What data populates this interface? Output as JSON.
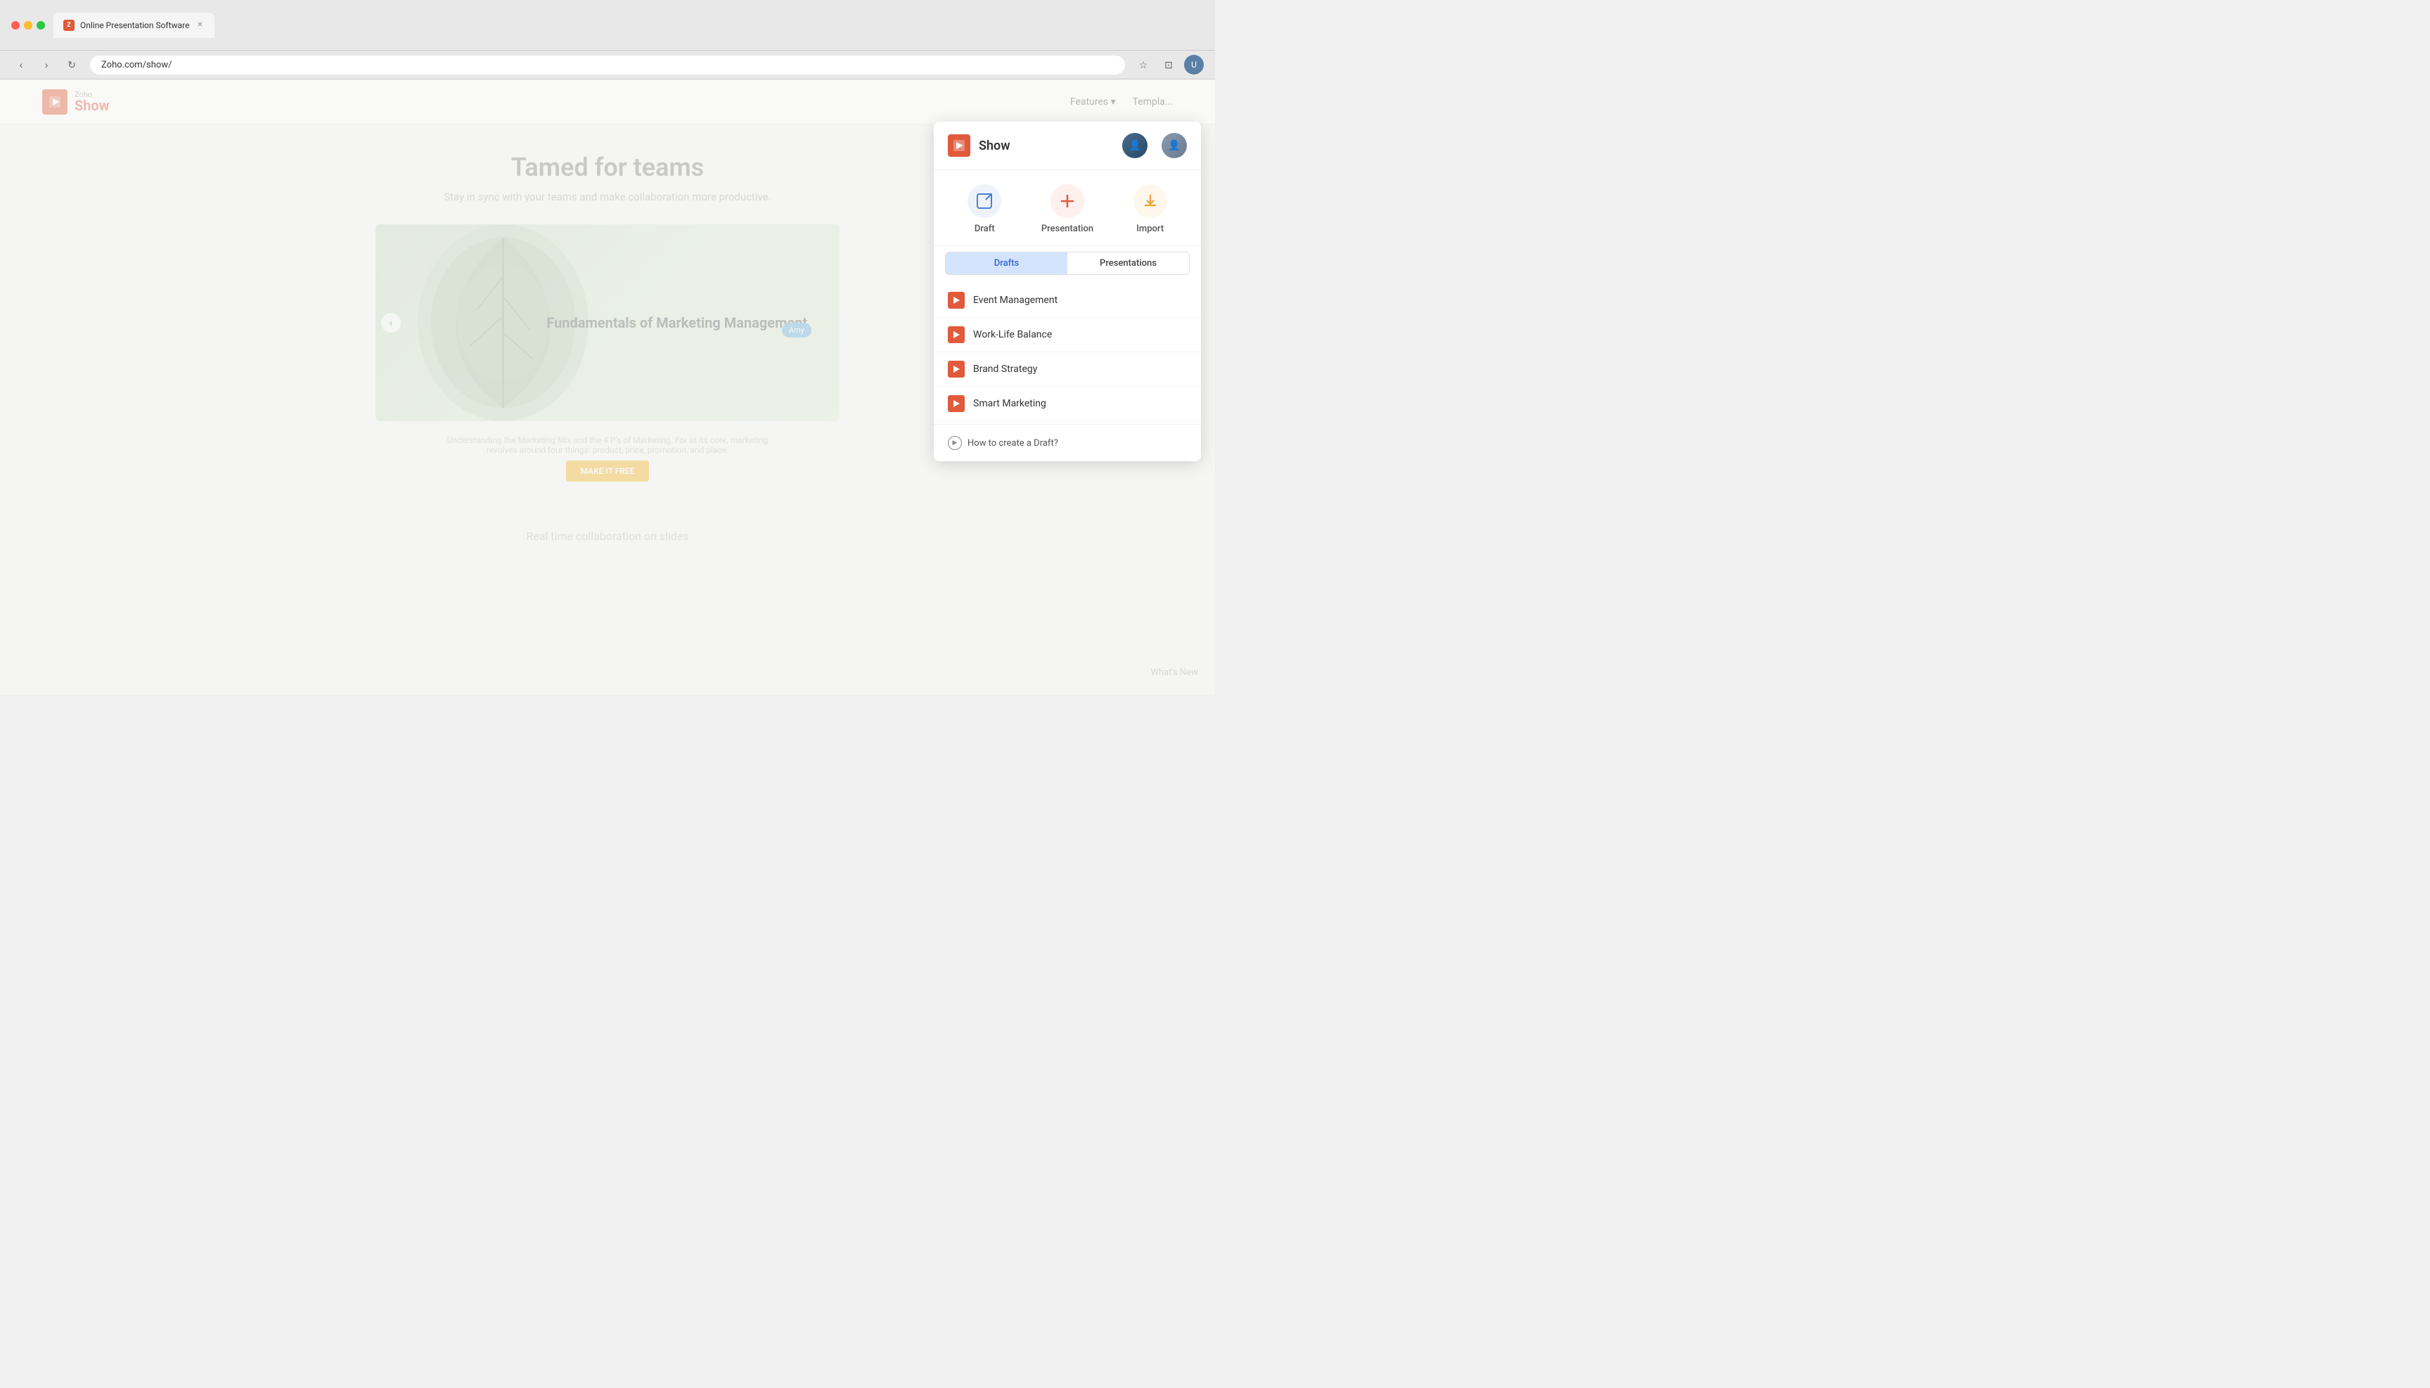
{
  "browser": {
    "tab_title": "Online Presentation Software",
    "url": "Zoho.com/show/",
    "favicon_text": "Z"
  },
  "site": {
    "logo_zoho": "Zoho",
    "logo_show": "Show",
    "nav_links": [
      {
        "label": "Features",
        "has_arrow": true
      },
      {
        "label": "Templa..."
      }
    ],
    "hero_title": "Tamed for teams",
    "hero_subtitle": "Stay in sync with your teams and make collaboration more productive.",
    "slide_title": "Fundamentals of Marketing Management.",
    "avatar_label": "Amy",
    "hero_description": "Understanding the Marketing Mix and the 4 P's of Marketing. For at its core, marketing revolves around four things: product, price, promotion, and place.",
    "cta_label": "MAKE IT FREE",
    "bottom_title": "Real time collaboration on slides",
    "whats_new": "What's New"
  },
  "popup": {
    "title": "Show",
    "action_draft": "Draft",
    "action_presentation": "Presentation",
    "action_import": "Import",
    "tab_drafts": "Drafts",
    "tab_presentations": "Presentations",
    "list_items": [
      {
        "name": "Event Management"
      },
      {
        "name": "Work-Life Balance"
      },
      {
        "name": "Brand Strategy"
      },
      {
        "name": "Smart Marketing"
      }
    ],
    "footer_link": "How to create a Draft?"
  }
}
